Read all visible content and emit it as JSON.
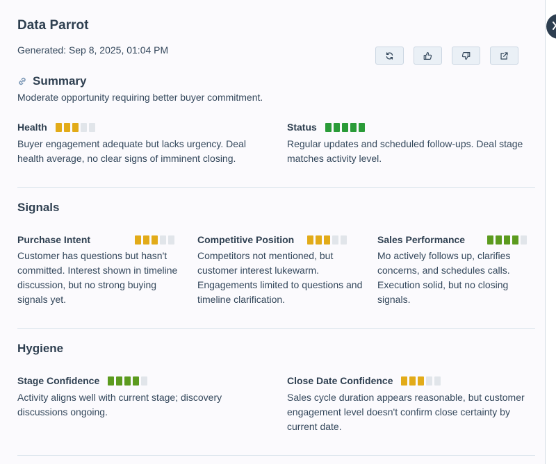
{
  "header": {
    "title": "Data Parrot",
    "generated": "Generated: Sep 8, 2025, 01:04 PM"
  },
  "actions": [
    {
      "name": "refresh-button",
      "icon": "refresh-icon"
    },
    {
      "name": "thumbs-up-button",
      "icon": "thumbs-up-icon"
    },
    {
      "name": "thumbs-down-button",
      "icon": "thumbs-down-icon"
    },
    {
      "name": "open-external-button",
      "icon": "external-link-icon"
    }
  ],
  "summary": {
    "heading": "Summary",
    "icon": "link-icon",
    "text": "Moderate opportunity requiring better buyer commitment."
  },
  "health": {
    "label": "Health",
    "score": 3,
    "max": 5,
    "color": "#e2ab19",
    "text": "Buyer engagement adequate but lacks urgency. Deal health average, no clear signs of imminent closing."
  },
  "status": {
    "label": "Status",
    "score": 5,
    "max": 5,
    "color": "#2a9b38",
    "text": "Regular updates and scheduled follow-ups. Deal stage matches activity level."
  },
  "signals": {
    "heading": "Signals",
    "items": [
      {
        "label": "Purchase Intent",
        "score": 3,
        "max": 5,
        "color": "#e2ab19",
        "text": "Customer has questions but hasn't committed. Interest shown in timeline discussion, but no strong buying signals yet."
      },
      {
        "label": "Competitive Position",
        "score": 3,
        "max": 5,
        "color": "#e2ab19",
        "text": "Competitors not mentioned, but customer interest lukewarm. Engagements limited to questions and timeline clarification."
      },
      {
        "label": "Sales Performance",
        "score": 4,
        "max": 5,
        "color": "#5c9b1f",
        "text": "Mo actively follows up, clarifies concerns, and schedules calls. Execution solid, but no closing signals."
      }
    ]
  },
  "hygiene": {
    "heading": "Hygiene",
    "items": [
      {
        "label": "Stage Confidence",
        "score": 4,
        "max": 5,
        "color": "#5c9b1f",
        "text": "Activity aligns well with current stage; discovery discussions ongoing."
      },
      {
        "label": "Close Date Confidence",
        "score": 3,
        "max": 5,
        "color": "#e2ab19",
        "text": "Sales cycle duration appears reasonable, but customer engagement level doesn't confirm close certainty by current date."
      }
    ]
  }
}
